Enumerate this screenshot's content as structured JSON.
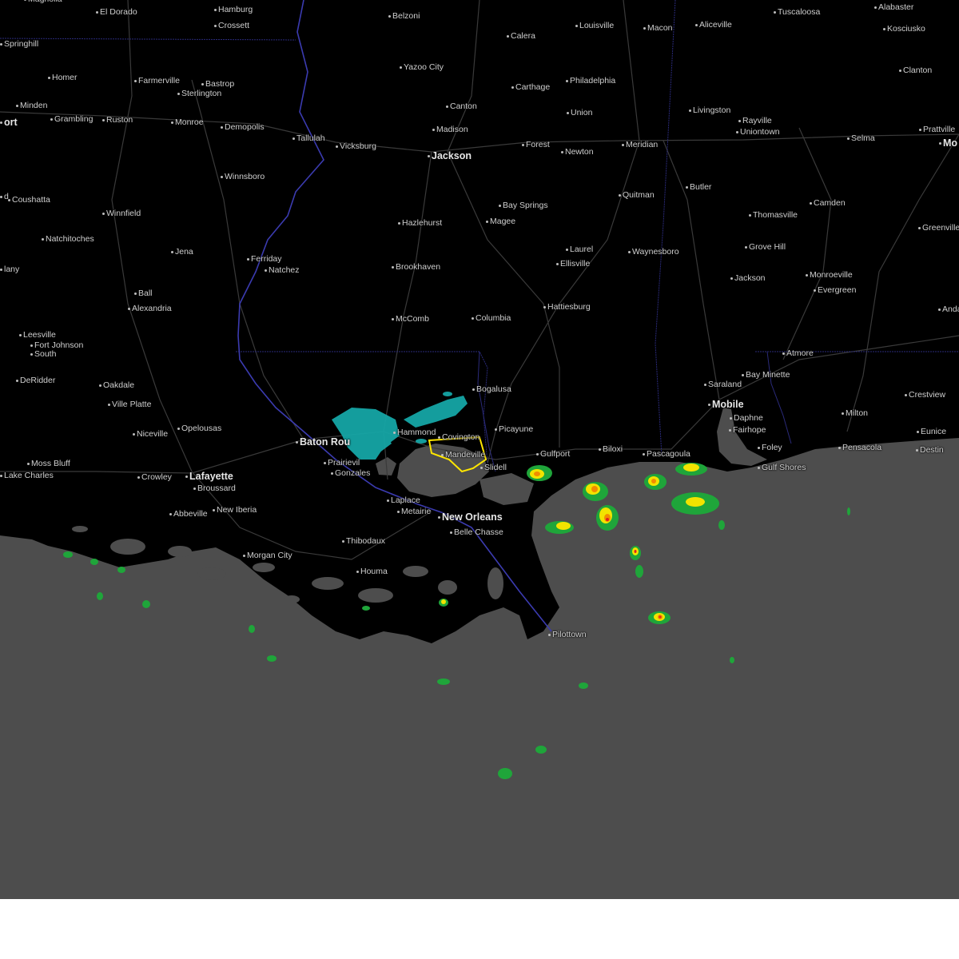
{
  "map": {
    "colors": {
      "land": "#000000",
      "water": "#4d4d4d",
      "roads": "#3a3a3a",
      "state_border": "#2a2a7a",
      "river": "#3b3bb0",
      "warning_outline": "#ffe600",
      "radar_light": "#16a6a6",
      "radar_green": "#1fa53a",
      "radar_yellow": "#f2e300",
      "radar_orange": "#f28c00",
      "radar_red": "#e02020"
    },
    "warning_area": "Mandeville",
    "cities": [
      {
        "name": "Magnolia",
        "major": false
      },
      {
        "name": "El Dorado",
        "major": false
      },
      {
        "name": "Hamburg",
        "major": false
      },
      {
        "name": "Belzoni",
        "major": false
      },
      {
        "name": "Louisville",
        "major": false
      },
      {
        "name": "Macon",
        "major": false
      },
      {
        "name": "Aliceville",
        "major": false
      },
      {
        "name": "Tuscaloosa",
        "major": false
      },
      {
        "name": "Alabaster",
        "major": false
      },
      {
        "name": "Crossett",
        "major": false
      },
      {
        "name": "Springhill",
        "major": false
      },
      {
        "name": "Kosciusko",
        "major": false
      },
      {
        "name": "Calera",
        "major": false
      },
      {
        "name": "Yazoo City",
        "major": false
      },
      {
        "name": "Clanton",
        "major": false
      },
      {
        "name": "Homer",
        "major": false
      },
      {
        "name": "Farmerville",
        "major": false
      },
      {
        "name": "Bastrop",
        "major": false
      },
      {
        "name": "Philadelphia",
        "major": false
      },
      {
        "name": "Carthage",
        "major": false
      },
      {
        "name": "Sterlington",
        "major": false
      },
      {
        "name": "Minden",
        "major": false
      },
      {
        "name": "Canton",
        "major": false
      },
      {
        "name": "Livingston",
        "major": false
      },
      {
        "name": "Union",
        "major": false
      },
      {
        "name": "Grambling",
        "major": false
      },
      {
        "name": "Ruston",
        "major": false
      },
      {
        "name": "Monroe",
        "major": false
      },
      {
        "name": "Demopolis",
        "major": false
      },
      {
        "name": "Rayville",
        "major": false
      },
      {
        "name": "Madison",
        "major": false
      },
      {
        "name": "Prattville",
        "major": false
      },
      {
        "name": "Uniontown",
        "major": false
      },
      {
        "name": "Tallulah",
        "major": false
      },
      {
        "name": "Selma",
        "major": false
      },
      {
        "name": "Forest",
        "major": false
      },
      {
        "name": "Meridian",
        "major": false
      },
      {
        "name": "Vicksburg",
        "major": false
      },
      {
        "name": "Newton",
        "major": false
      },
      {
        "name": "Jackson",
        "major": true
      },
      {
        "name": "Winnsboro",
        "major": false
      },
      {
        "name": "Butler",
        "major": false
      },
      {
        "name": "Quitman",
        "major": false
      },
      {
        "name": "Coushatta",
        "major": false
      },
      {
        "name": "Bay Springs",
        "major": false
      },
      {
        "name": "Camden",
        "major": false
      },
      {
        "name": "Winnfield",
        "major": false
      },
      {
        "name": "Thomasville",
        "major": false
      },
      {
        "name": "Hazlehurst",
        "major": false
      },
      {
        "name": "Magee",
        "major": false
      },
      {
        "name": "Greenville",
        "major": false
      },
      {
        "name": "Natchitoches",
        "major": false
      },
      {
        "name": "Grove Hill",
        "major": false
      },
      {
        "name": "Jena",
        "major": false
      },
      {
        "name": "Laurel",
        "major": false
      },
      {
        "name": "Waynesboro",
        "major": false
      },
      {
        "name": "Ferriday",
        "major": false
      },
      {
        "name": "Ellisville",
        "major": false
      },
      {
        "name": "Brookhaven",
        "major": false
      },
      {
        "name": "Natchez",
        "major": false
      },
      {
        "name": "Jackson",
        "major": false
      },
      {
        "name": "Monroeville",
        "major": false
      },
      {
        "name": "Evergreen",
        "major": false
      },
      {
        "name": "Ball",
        "major": false
      },
      {
        "name": "Alexandria",
        "major": false
      },
      {
        "name": "Hattiesburg",
        "major": false
      },
      {
        "name": "Andalusia",
        "major": false
      },
      {
        "name": "McComb",
        "major": false
      },
      {
        "name": "Columbia",
        "major": false
      },
      {
        "name": "Leesville",
        "major": false
      },
      {
        "name": "Fort Johnson",
        "major": false
      },
      {
        "name": "South",
        "major": false
      },
      {
        "name": "Atmore",
        "major": false
      },
      {
        "name": "Bay Minette",
        "major": false
      },
      {
        "name": "DeRidder",
        "major": false
      },
      {
        "name": "Saraland",
        "major": false
      },
      {
        "name": "Oakdale",
        "major": false
      },
      {
        "name": "Bogalusa",
        "major": false
      },
      {
        "name": "Crestview",
        "major": false
      },
      {
        "name": "Mobile",
        "major": true
      },
      {
        "name": "Ville Platte",
        "major": false
      },
      {
        "name": "Milton",
        "major": false
      },
      {
        "name": "Daphne",
        "major": false
      },
      {
        "name": "Opelousas",
        "major": false
      },
      {
        "name": "Picayune",
        "major": false
      },
      {
        "name": "Fairhope",
        "major": false
      },
      {
        "name": "Niceville",
        "major": false
      },
      {
        "name": "Eunice",
        "major": false
      },
      {
        "name": "Hammond",
        "major": false
      },
      {
        "name": "Covington",
        "major": false
      },
      {
        "name": "Baton Rou",
        "major": true
      },
      {
        "name": "Foley",
        "major": false
      },
      {
        "name": "Pensacola",
        "major": false
      },
      {
        "name": "Biloxi",
        "major": false
      },
      {
        "name": "Destin",
        "major": false
      },
      {
        "name": "Gulfport",
        "major": false
      },
      {
        "name": "Pascagoula",
        "major": false
      },
      {
        "name": "Mandeville",
        "major": false
      },
      {
        "name": "Prairievil",
        "major": false
      },
      {
        "name": "Moss Bluff",
        "major": false
      },
      {
        "name": "Slidell",
        "major": false
      },
      {
        "name": "Gulf Shores",
        "major": false
      },
      {
        "name": "Gonzales",
        "major": false
      },
      {
        "name": "Lake Charles",
        "major": false
      },
      {
        "name": "Crowley",
        "major": false
      },
      {
        "name": "Lafayette",
        "major": true
      },
      {
        "name": "Broussard",
        "major": false
      },
      {
        "name": "Laplace",
        "major": false
      },
      {
        "name": "Metairie",
        "major": false
      },
      {
        "name": "New Orleans",
        "major": true
      },
      {
        "name": "Abbeville",
        "major": false
      },
      {
        "name": "New Iberia",
        "major": false
      },
      {
        "name": "Belle Chasse",
        "major": false
      },
      {
        "name": "Thibodaux",
        "major": false
      },
      {
        "name": "Morgan City",
        "major": false
      },
      {
        "name": "Houma",
        "major": false
      },
      {
        "name": "Pilottown",
        "major": false
      },
      {
        "name": "ort",
        "major": true
      },
      {
        "name": "Mo",
        "major": true
      },
      {
        "name": "d",
        "major": false
      },
      {
        "name": "lany",
        "major": false
      }
    ]
  }
}
